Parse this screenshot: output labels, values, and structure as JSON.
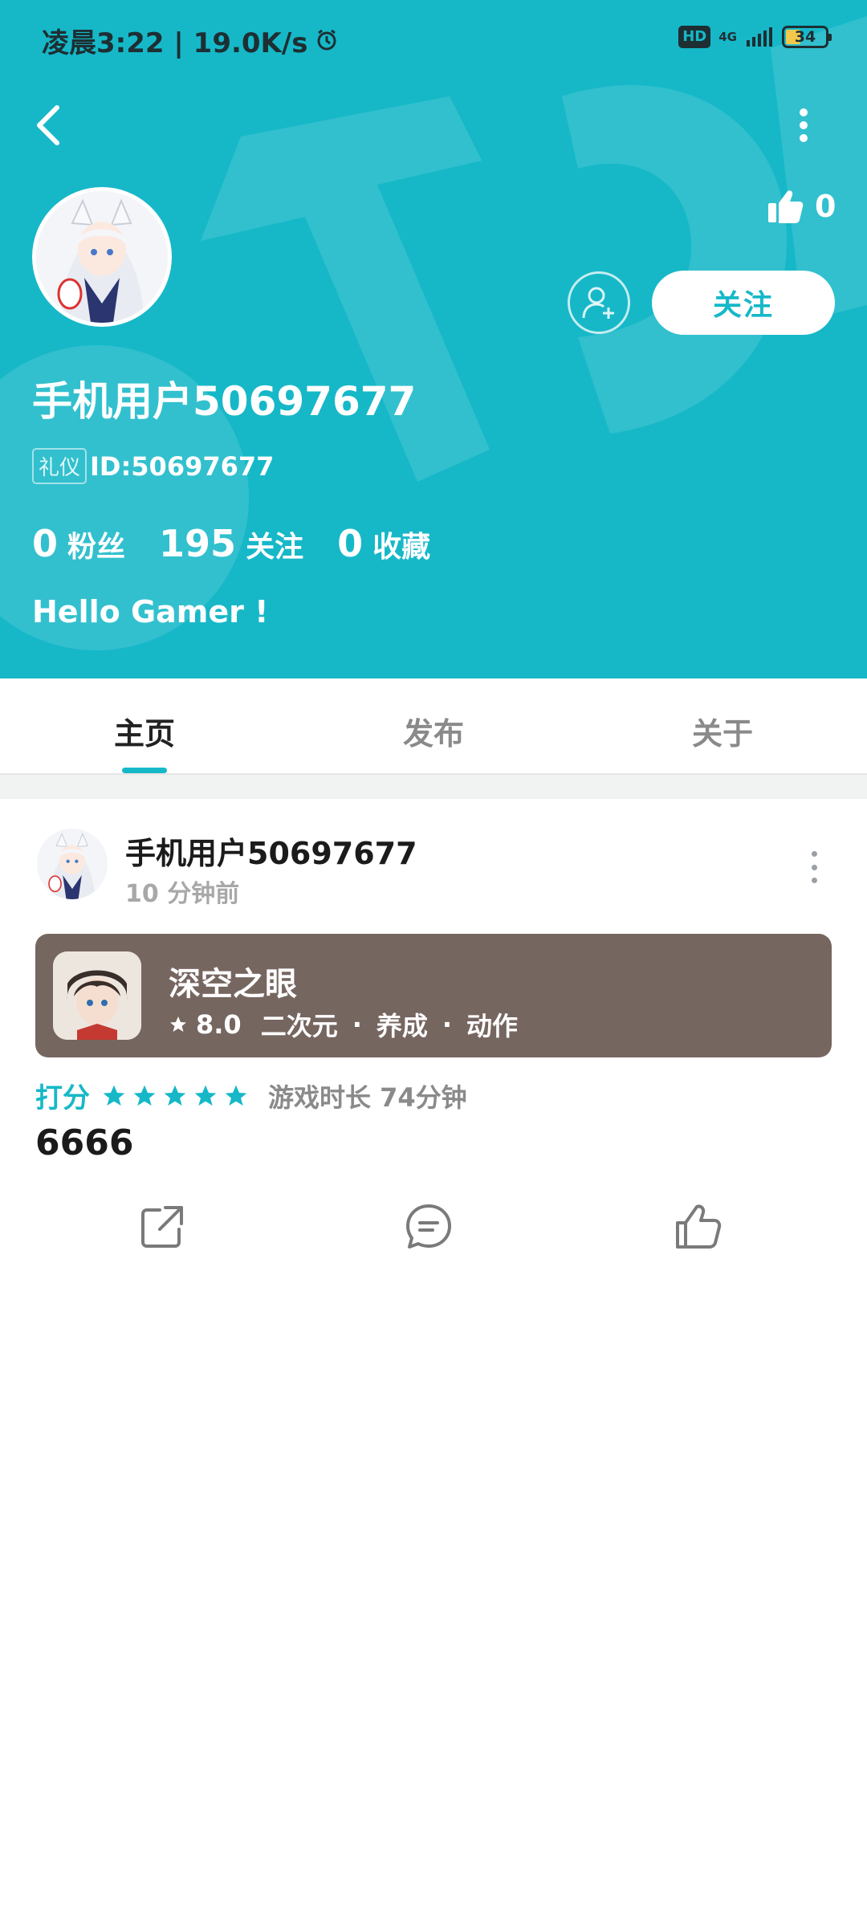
{
  "status_bar": {
    "time_speed": "凌晨3:22 | 19.0K/s",
    "hd_label": "HD",
    "network": "4G",
    "battery": "34"
  },
  "header": {
    "like_count": "0",
    "follow_label": "关注",
    "username": "手机用户50697677",
    "badge": "礼仪",
    "id_text": "ID:50697677",
    "stats": [
      {
        "value": "0",
        "label": "粉丝"
      },
      {
        "value": "195",
        "label": "关注"
      },
      {
        "value": "0",
        "label": "收藏"
      }
    ],
    "bio": "Hello Gamer !",
    "background_color": "#16b8c8"
  },
  "tabs": [
    {
      "label": "主页",
      "active": true
    },
    {
      "label": "发布",
      "active": false
    },
    {
      "label": "关于",
      "active": false
    }
  ],
  "post": {
    "username": "手机用户50697677",
    "time": "10 分钟前",
    "game": {
      "title": "深空之眼",
      "score": "8.0",
      "tags": [
        "二次元",
        "养成",
        "动作"
      ],
      "separator": "·",
      "card_color": "#766660"
    },
    "rating_label": "打分",
    "stars": 5,
    "playtime": "游戏时长 74分钟",
    "text": "6666"
  }
}
